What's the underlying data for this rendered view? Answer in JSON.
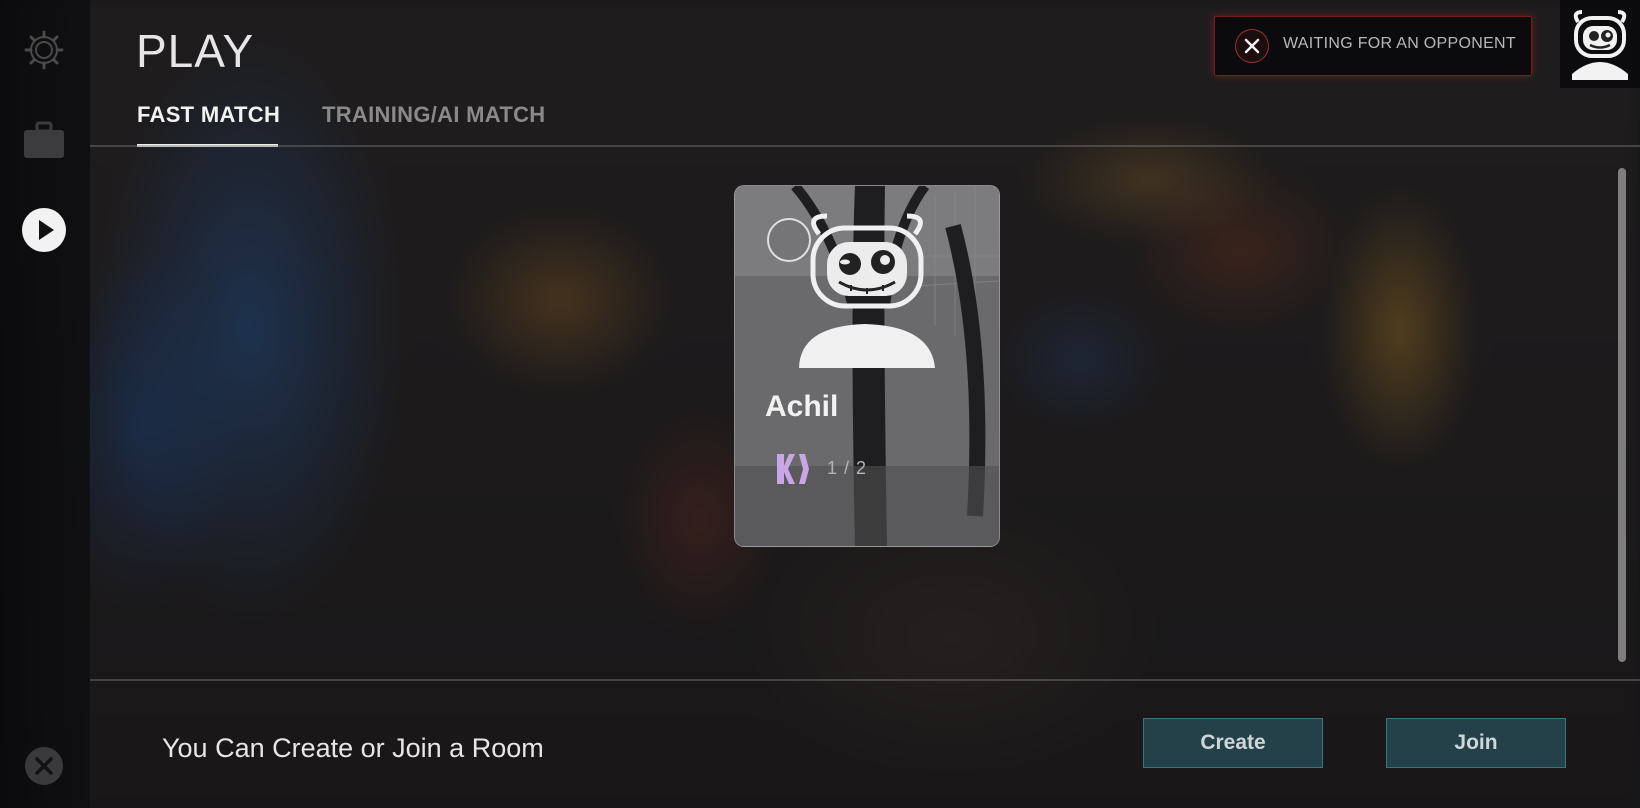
{
  "header": {
    "title": "PLAY",
    "tabs": [
      {
        "label": "FAST MATCH",
        "active": true
      },
      {
        "label": "TRAINING/AI MATCH",
        "active": false
      }
    ]
  },
  "sidebar": {
    "items": [
      {
        "icon": "gear-icon",
        "active": false
      },
      {
        "icon": "briefcase-icon",
        "active": false
      },
      {
        "icon": "play-icon",
        "active": true
      },
      {
        "icon": "close-icon",
        "active": false
      }
    ]
  },
  "notification": {
    "text": "WAITING FOR AN OPPONENT",
    "close_icon": "close-icon",
    "accent": "#c0303a"
  },
  "room_card": {
    "player_name": "Achil",
    "player_count": "1 / 2",
    "logo_icon": "team-logo-icon",
    "logo_color": "#c9a6e6"
  },
  "footer": {
    "message": "You Can Create or Join a Room",
    "create_label": "Create",
    "join_label": "Join"
  },
  "colors": {
    "button_bg": "#28505a",
    "button_border": "#468c96",
    "tab_active": "#f2f2f2",
    "tab_inactive": "#8a8a8a"
  }
}
